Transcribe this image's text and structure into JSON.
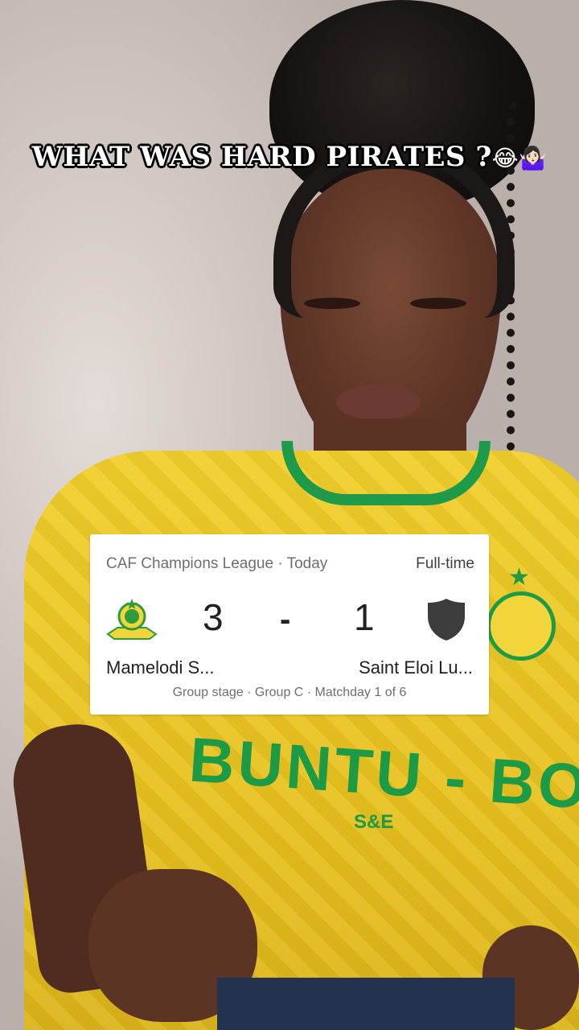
{
  "caption": {
    "text": "WHAT WAS HARD PIRATES ?",
    "emojis": "😂🤷🏻‍♀️"
  },
  "match_card": {
    "league_line": "CAF Champions League · Today",
    "status": "Full-time",
    "home_team": {
      "name": "Mamelodi S...",
      "score": "3",
      "logo_icon": "sundowns-crest-icon",
      "logo_colors": {
        "primary": "#f2d53a",
        "secondary": "#2e9b3c"
      }
    },
    "separator": "-",
    "away_team": {
      "name": "Saint Eloi Lu...",
      "score": "1",
      "logo_icon": "shield-placeholder-icon",
      "logo_color": "#3c3c3c"
    },
    "stage_line": "Group stage · Group C · Matchday 1 of 6"
  },
  "jersey": {
    "text": "BUNTU - BOTH",
    "sub_text": "S&E",
    "colors": {
      "shirt": "#f1cf2c",
      "trim": "#1c9a46"
    }
  }
}
